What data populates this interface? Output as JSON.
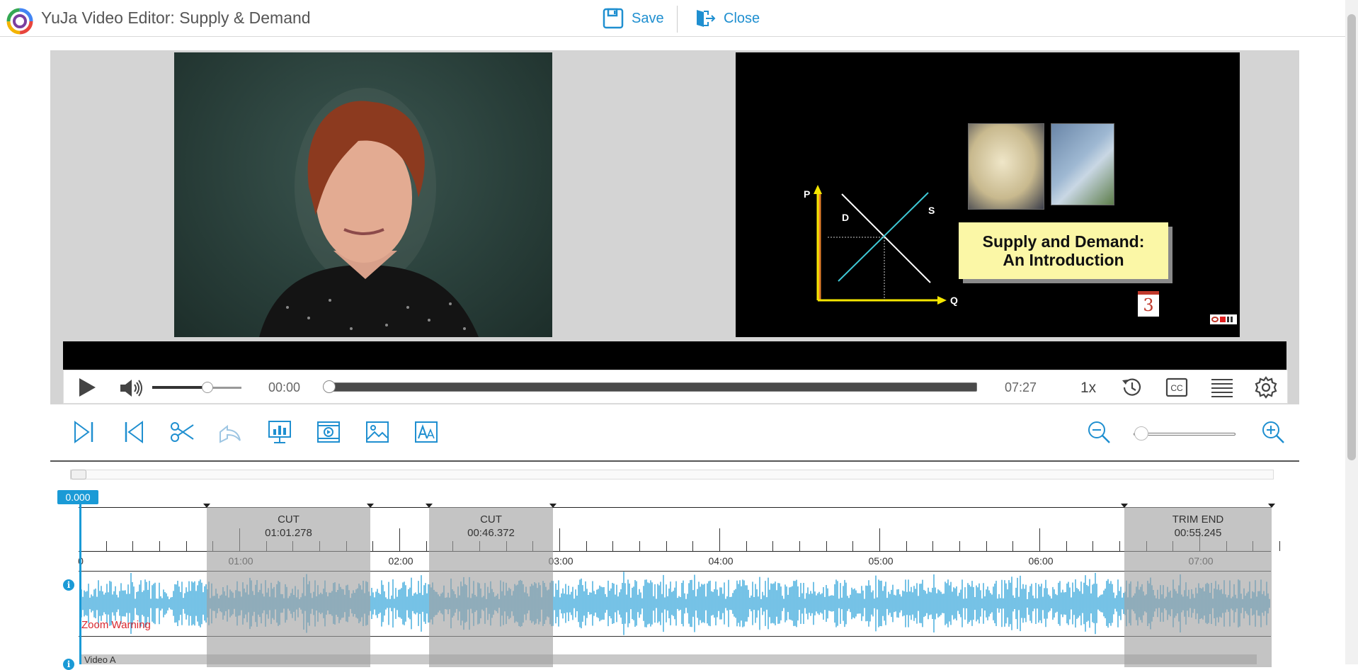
{
  "header": {
    "app_title": "YuJa Video Editor: Supply & Demand",
    "save_label": "Save",
    "close_label": "Close"
  },
  "slide": {
    "title_line1": "Supply and Demand:",
    "title_line2": "An Introduction",
    "axis_p": "P",
    "axis_q": "Q",
    "curve_d": "D",
    "curve_s": "S",
    "chapter_number": "3"
  },
  "player": {
    "current_time": "00:00",
    "duration": "07:27",
    "speed": "1x",
    "volume_level": 0.62,
    "progress": 0
  },
  "timeline": {
    "playhead_value": "0.000",
    "time_labels": [
      "0",
      "01:00",
      "02:00",
      "03:00",
      "04:00",
      "05:00",
      "06:00",
      "07:00"
    ],
    "cuts": [
      {
        "label": "CUT",
        "duration": "01:01.278"
      },
      {
        "label": "CUT",
        "duration": "00:46.372"
      },
      {
        "label": "TRIM END",
        "duration": "00:55.245"
      }
    ],
    "zoom_warning": "Zoom Warning",
    "track_label": "Video A"
  },
  "colors": {
    "accent": "#1a9ad6",
    "link": "#1f8fd0",
    "warning": "#d9272e",
    "cut_overlay": "#a0a0a0"
  },
  "icons": {
    "toolbar": [
      "jump-to-end-icon",
      "jump-to-start-icon",
      "scissors-icon",
      "undo-icon",
      "presentation-chart-icon",
      "video-insert-icon",
      "image-insert-icon",
      "text-insert-icon"
    ],
    "player": [
      "play-icon",
      "volume-icon",
      "history-icon",
      "closed-captions-icon",
      "chapters-list-icon",
      "settings-gear-icon"
    ]
  }
}
